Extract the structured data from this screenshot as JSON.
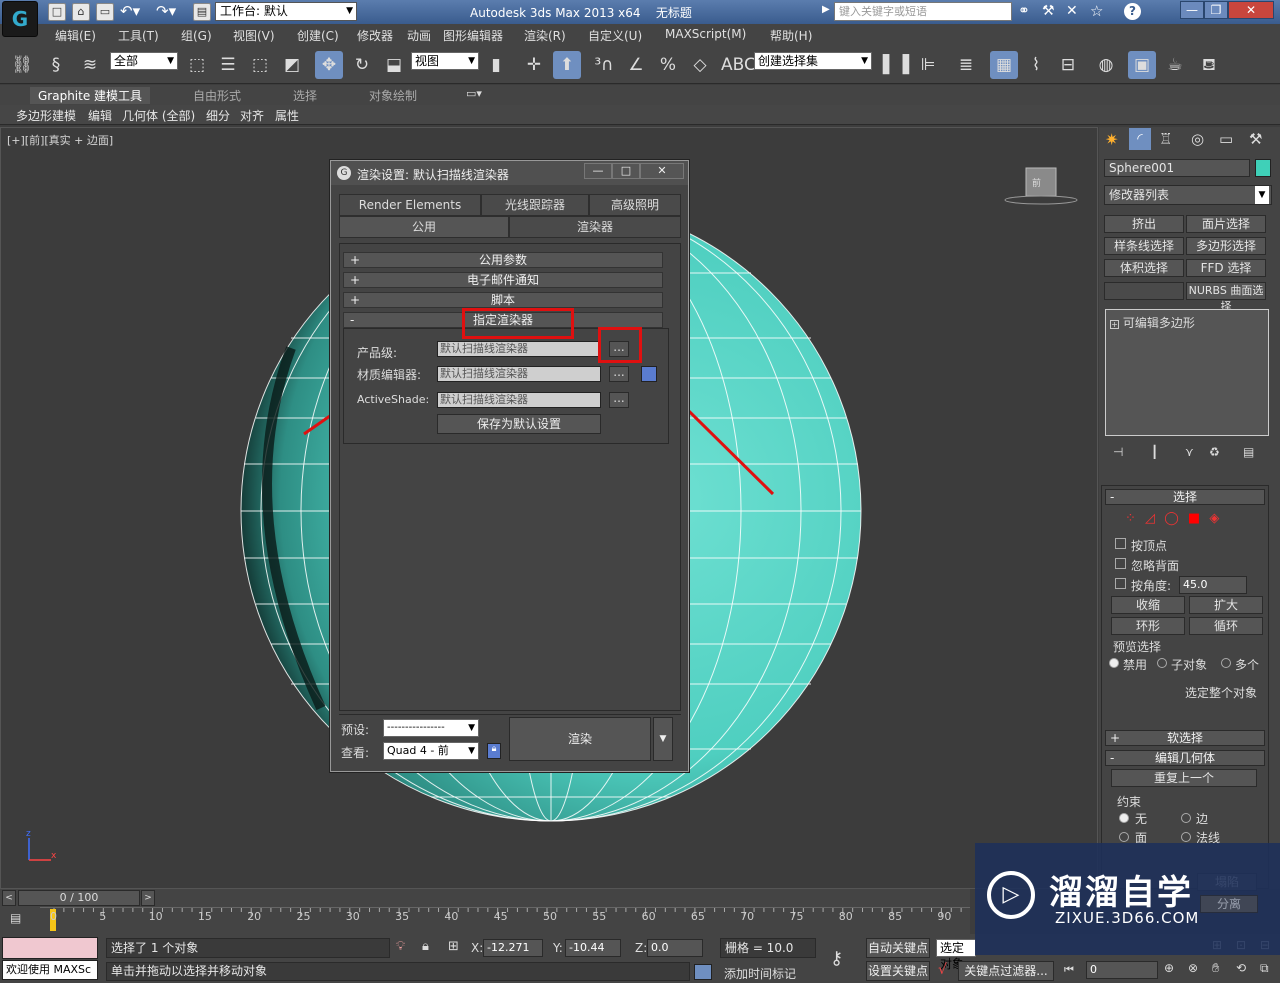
{
  "app": {
    "title": "Autodesk 3ds Max  2013 x64",
    "doc": "无标题",
    "workspace": "工作台: 默认",
    "search_placeholder": "键入关键字或短语"
  },
  "menu": [
    "编辑(E)",
    "工具(T)",
    "组(G)",
    "视图(V)",
    "创建(C)",
    "修改器",
    "动画",
    "图形编辑器",
    "渲染(R)",
    "自定义(U)",
    "MAXScript(M)",
    "帮助(H)"
  ],
  "toolbar": {
    "filter": "全部",
    "refcoord": "视图",
    "selset": "创建选择集"
  },
  "ribbon": {
    "tabs": [
      "Graphite 建模工具",
      "自由形式",
      "选择",
      "对象绘制"
    ],
    "items": [
      "多边形建模",
      "编辑",
      "几何体 (全部)",
      "细分",
      "对齐",
      "属性"
    ]
  },
  "viewport": {
    "label": "[+][前][真实 + 边面]",
    "sphere_color": "#4fcfc0"
  },
  "dialog": {
    "title": "渲染设置: 默认扫描线渲染器",
    "tabs_top": [
      "Render Elements",
      "光线跟踪器",
      "高级照明"
    ],
    "tabs_bottom": [
      "公用",
      "渲染器"
    ],
    "rollups": [
      "公用参数",
      "电子邮件通知",
      "脚本",
      "指定渲染器"
    ],
    "rollup_signs": [
      "+",
      "+",
      "+",
      "-"
    ],
    "rows": [
      {
        "label": "产品级:",
        "value": "默认扫描线渲染器"
      },
      {
        "label": "材质编辑器:",
        "value": "默认扫描线渲染器"
      },
      {
        "label": "ActiveShade:",
        "value": "默认扫描线渲染器"
      }
    ],
    "browse": "...",
    "save_default": "保存为默认设置",
    "preset_label": "预设:",
    "preset_value": "----------------",
    "view_label": "查看:",
    "view_value": "Quad 4 - 前",
    "render": "渲染"
  },
  "cmd": {
    "object_name": "Sphere001",
    "object_color": "#3fd0b8",
    "modlist": "修改器列表",
    "buttons": [
      "挤出",
      "面片选择",
      "样条线选择",
      "多边形选择",
      "体积选择",
      "FFD 选择",
      "",
      "NURBS 曲面选择"
    ],
    "stack_item": "可编辑多边形",
    "select_title": "选择",
    "by_vertex": "按顶点",
    "ignore_back": "忽略背面",
    "by_angle": "按角度:",
    "angle": "45.0",
    "shrink": "收缩",
    "grow": "扩大",
    "ring": "环形",
    "loop": "循环",
    "preview": "预览选择",
    "disabled": "禁用",
    "subobj": "子对象",
    "multi": "多个",
    "sel_whole": "选定整个对象",
    "soft": "软选择",
    "edit_geo": "编辑几何体",
    "repeat": "重复上一个",
    "constraint": "约束",
    "none": "无",
    "edge": "边",
    "face": "面",
    "normal": "法线",
    "collapse": "塌陷",
    "detach": "分离"
  },
  "timeline": {
    "frame": "0 / 100",
    "ticks": [
      "0",
      "5",
      "10",
      "15",
      "20",
      "25",
      "30",
      "35",
      "40",
      "45",
      "50",
      "55",
      "60",
      "65",
      "70",
      "75",
      "80",
      "85",
      "90"
    ]
  },
  "status": {
    "welcome": "欢迎使用 MAXSc",
    "selected": "选择了 1 个对象",
    "hint": "单击并拖动以选择并移动对象",
    "x": "-12.271",
    "y": "-10.44",
    "z": "0.0",
    "grid": "栅格 = 10.0",
    "autokey": "自动关键点",
    "setkey": "设置关键点",
    "selobj": "选定对象",
    "keyfilter": "关键点过滤器...",
    "addtime": "添加时间标记",
    "frame": "0"
  },
  "watermark": {
    "title": "溜溜自学",
    "url": "ZIXUE.3D66.COM"
  }
}
